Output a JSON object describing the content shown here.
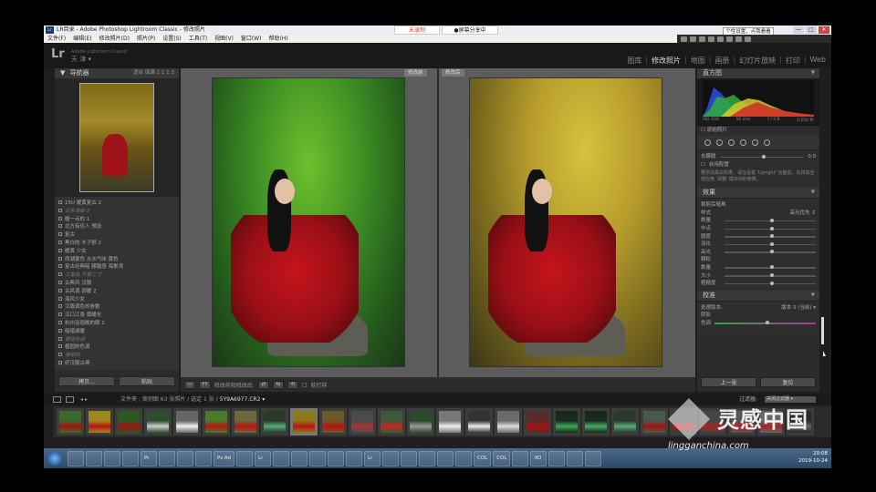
{
  "window": {
    "title": "LR目录 - Adobe Photoshop Lightroom Classic - 修改照片",
    "lr_badge": "Lr",
    "recording_tab": "未录制",
    "share_tab": "●屏幕分享中",
    "tooltip": "个性设置，点我看看",
    "buttons": [
      "—",
      "□",
      "✕"
    ]
  },
  "menu": [
    "文件(F)",
    "编辑(E)",
    "修改照片(D)",
    "照片(P)",
    "设置(S)",
    "工具(T)",
    "视图(V)",
    "窗口(W)",
    "帮助(H)"
  ],
  "identity": {
    "logo": "Lr",
    "sub": "Adobe Lightroom Classic",
    "name": "天 津 ▾"
  },
  "modules": [
    {
      "label": "图库",
      "active": false
    },
    {
      "label": "修改照片",
      "active": true
    },
    {
      "label": "地图",
      "active": false
    },
    {
      "label": "画册",
      "active": false
    },
    {
      "label": "幻灯片放映",
      "active": false
    },
    {
      "label": "打印",
      "active": false
    },
    {
      "label": "Web",
      "active": false
    }
  ],
  "left_panel": {
    "navigator": {
      "title": "导航器",
      "options": "适合  填满  1:1  1:3"
    },
    "presets": [
      {
        "label": "15U 暖黄复古 2",
        "dim": false
      },
      {
        "label": "日系清新 2",
        "dim": true
      },
      {
        "label": "暖一点的 1",
        "dim": false
      },
      {
        "label": "北方有佳人 预设",
        "dim": false
      },
      {
        "label": "复古",
        "dim": false
      },
      {
        "label": "黑白的 木子剧 2",
        "dim": false
      },
      {
        "label": "暖黄 少女",
        "dim": false
      },
      {
        "label": "西湖夏色 水水气味 黄色",
        "dim": false
      },
      {
        "label": "复古经典暗 朦胧感 海棠湾",
        "dim": false
      },
      {
        "label": "工笔画 不要二寸",
        "dim": true
      },
      {
        "label": "古典风 汉服",
        "dim": false
      },
      {
        "label": "古风调 调暖 2",
        "dim": false
      },
      {
        "label": "海风少女",
        "dim": false
      },
      {
        "label": "汉服调色的参数",
        "dim": false
      },
      {
        "label": "汉口江景 黄暖化",
        "dim": false
      },
      {
        "label": "杭州浴雨晚的眼 2",
        "dim": false
      },
      {
        "label": "暗暗湖暖",
        "dim": false
      },
      {
        "label": "黄绿色调",
        "dim": true
      },
      {
        "label": "植园的色调",
        "dim": false
      },
      {
        "label": "清晰的",
        "dim": true
      },
      {
        "label": "好汉服古典",
        "dim": false
      }
    ],
    "copy_button": "拷贝...",
    "paste_button": "粘贴"
  },
  "center": {
    "before_label": "修改前",
    "after_label": "修改后"
  },
  "toolbar": {
    "label_before_after": "修改前和修改后:",
    "softproof": "软打样",
    "btn_view": "YY"
  },
  "right_panel": {
    "histogram_title": "直方图",
    "histo_info": [
      "ISO 100",
      "50 mm",
      "f / 2.8",
      "1/250 秒"
    ],
    "original_photo": "原始照片",
    "exposure_label": "去朦胧",
    "exposure_value": "0.0",
    "option_label": "启用配置",
    "note": "要添加黑白效果，请在设置 'Upright' 功能前，先将其全部应用 '调整' 模块中的参数。",
    "effects_title": "效果",
    "vignette_label": "裁剪后暗角",
    "style_label": "样式",
    "style_value": "高光优先 ↕",
    "rows_1": [
      "数量",
      "中点",
      "圆度",
      "羽化",
      "高光"
    ],
    "grain_label": "颗粒",
    "rows_2": [
      "数量",
      "大小",
      "粗糙度"
    ],
    "calibration_title": "校准",
    "process_label": "处理版本:",
    "process_value": "版本 5 (当前) ▾",
    "shadows_label": "阴影",
    "tint_label": "色调",
    "prev_button": "上一张",
    "reset_button": "复位"
  },
  "filmstrip": {
    "path_prefix": "文件夹 : 案例图",
    "path_count": "63 张照片 / 选定 1 张 /",
    "path_file": "5Y9A6977.CR2 ▾",
    "filter_label": "过滤器:",
    "filter_value": "关闭过滤器 ▾",
    "cells": [
      {
        "a": "#3a6a2a",
        "b": "#a11"
      },
      {
        "a": "#a0861f",
        "b": "#b11"
      },
      {
        "a": "#2a5a22",
        "b": "#a11"
      },
      {
        "a": "#2d4d2d",
        "b": "#ccc"
      },
      {
        "a": "#666",
        "b": "#eee"
      },
      {
        "a": "#4a7a2a",
        "b": "#b11"
      },
      {
        "a": "#6a6a3a",
        "b": "#b11"
      },
      {
        "a": "#2a3a2a",
        "b": "#5a7"
      },
      {
        "a": "#8a7a1a",
        "b": "#b11"
      },
      {
        "a": "#6a5a2a",
        "b": "#b11"
      },
      {
        "a": "#4a4a4a",
        "b": "#a33"
      },
      {
        "a": "#3a5a3a",
        "b": "#c22"
      },
      {
        "a": "#2a4a2a",
        "b": "#999"
      },
      {
        "a": "#777",
        "b": "#eee"
      },
      {
        "a": "#333",
        "b": "#eee"
      },
      {
        "a": "#6a6a6a",
        "b": "#ddd"
      },
      {
        "a": "#5a2a2a",
        "b": "#a11"
      },
      {
        "a": "#1a2a1a",
        "b": "#3a5"
      },
      {
        "a": "#1a2a1a",
        "b": "#4a6"
      },
      {
        "a": "#2a3a2a",
        "b": "#5a7"
      },
      {
        "a": "#4a5a4a",
        "b": "#a11"
      },
      {
        "a": "#3a3a3a",
        "b": "#b11"
      },
      {
        "a": "#444",
        "b": "#a22"
      },
      {
        "a": "#555",
        "b": "#b22"
      },
      {
        "a": "#666",
        "b": "#a22"
      },
      {
        "a": "#2a2a2a",
        "b": "#666"
      }
    ],
    "selected_index": 8
  },
  "taskbar": {
    "items": [
      "",
      "",
      "",
      "",
      "Pr",
      "",
      "",
      "",
      "Ps Ad",
      "",
      "Lr",
      "",
      "",
      "",
      "",
      "",
      "Lr",
      "",
      "",
      "",
      "",
      "",
      "COL",
      "COL",
      "",
      "XO",
      "",
      "",
      ""
    ],
    "time": "20:08",
    "date": "2019-10-24"
  },
  "watermark": {
    "text": "灵感中国",
    "url": "lingganchina.com"
  },
  "colors": {
    "accent": "#d6c33d",
    "panel": "#2c2c2c",
    "red_dress": "#a0121a"
  }
}
